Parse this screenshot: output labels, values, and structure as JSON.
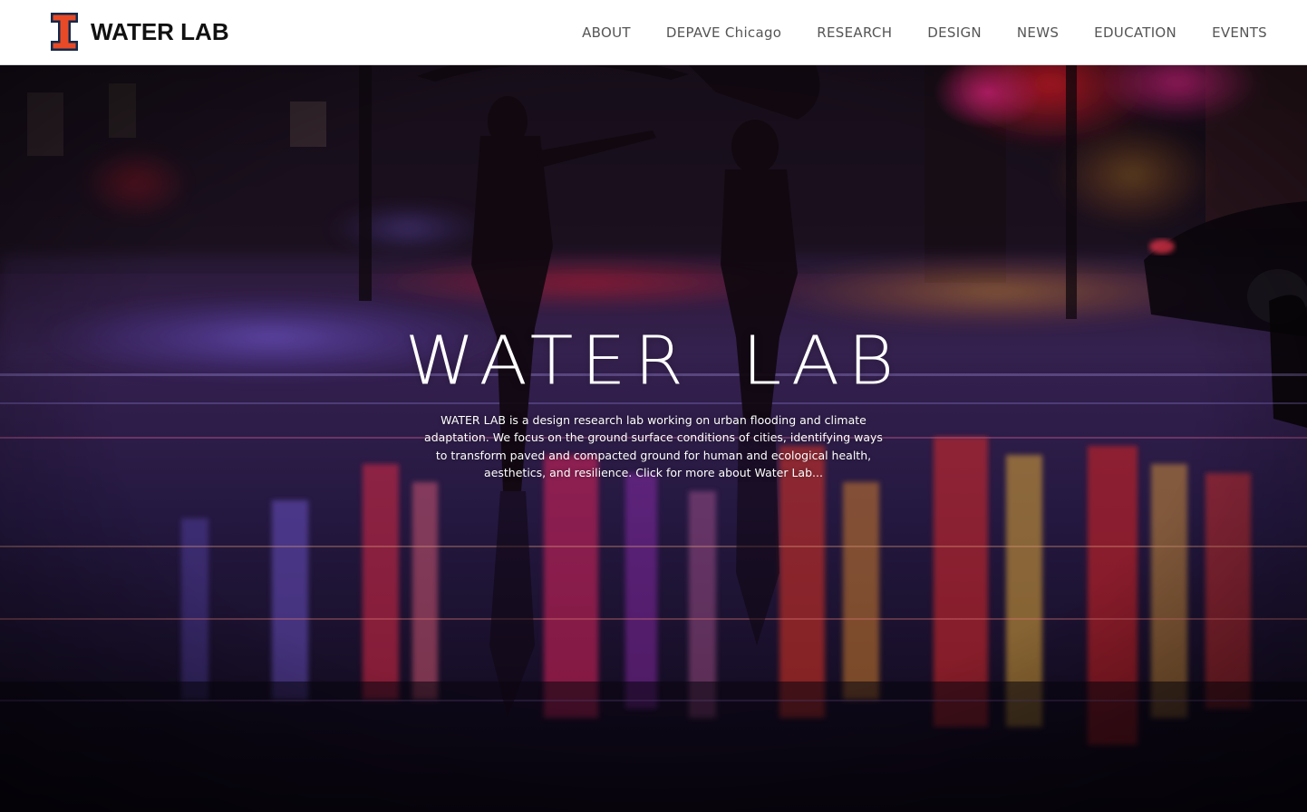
{
  "brand": {
    "name": "WATER LAB",
    "accent_color": "#e84a27",
    "navy_color": "#13294b",
    "icon": "block-i-icon"
  },
  "nav": {
    "items": [
      {
        "label": "ABOUT"
      },
      {
        "label": "DEPAVE Chicago"
      },
      {
        "label": "RESEARCH"
      },
      {
        "label": "DESIGN"
      },
      {
        "label": "NEWS"
      },
      {
        "label": "EDUCATION"
      },
      {
        "label": "EVENTS"
      }
    ]
  },
  "hero": {
    "title": "WATER LAB",
    "description": "WATER LAB is a design research lab working on urban flooding and climate adaptation. We focus on the ground surface conditions of cities, identifying ways to transform paved and compacted ground for human and ecological health, aesthetics, and resilience. Click for more about Water Lab..."
  }
}
